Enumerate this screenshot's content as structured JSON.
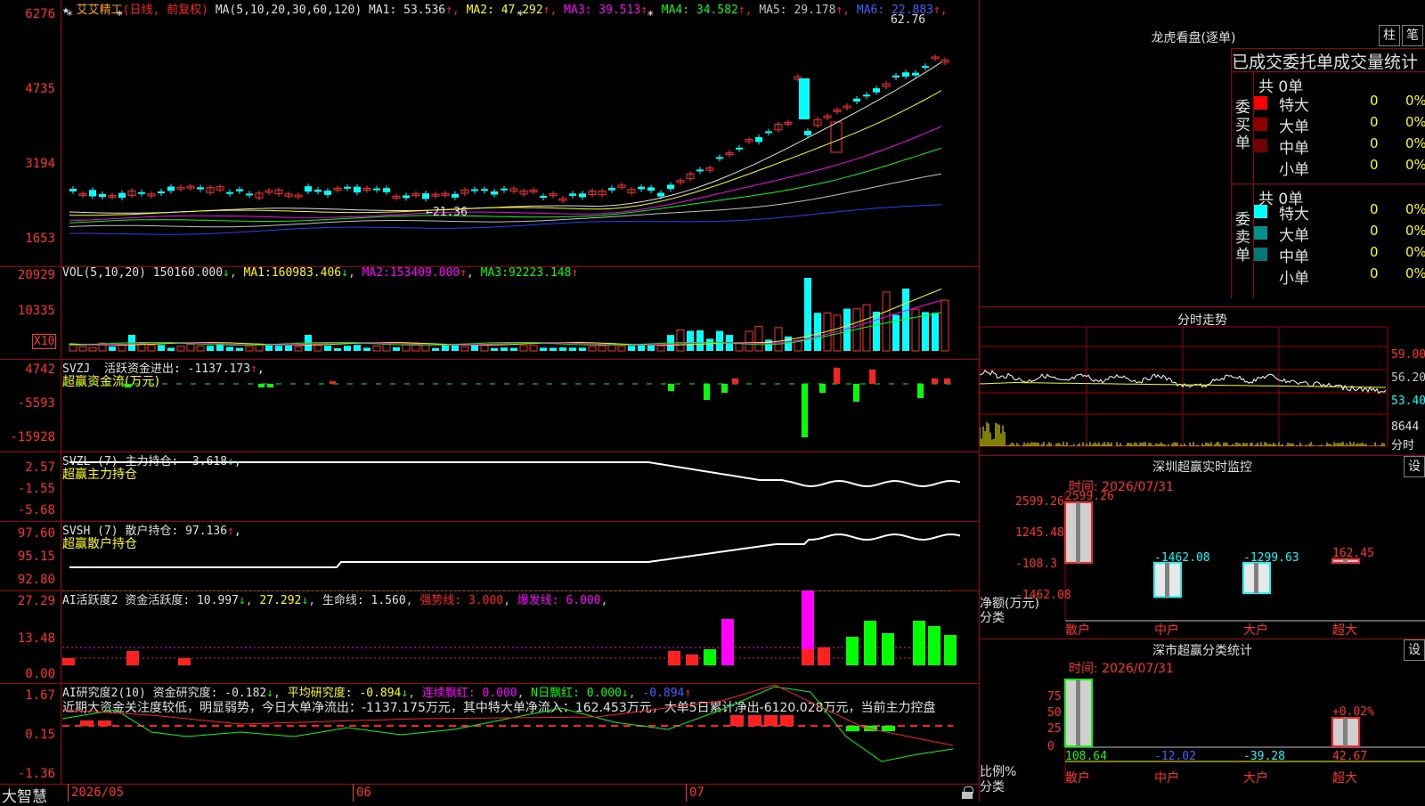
{
  "stock": {
    "name": "艾艾精工",
    "mode": "(日线, 前复权)",
    "ma_label": "MA(5,10,20,30,60,120)",
    "ma": [
      {
        "label": "MA1:",
        "value": "53.536",
        "arrow": "↑",
        "color": "#e0e0e0"
      },
      {
        "label": "MA2:",
        "value": "47.292",
        "arrow": "↑",
        "color": "#ffff00"
      },
      {
        "label": "MA3:",
        "value": "39.513",
        "arrow": "↑",
        "color": "#ff00ff"
      },
      {
        "label": "MA4:",
        "value": "34.582",
        "arrow": "↑",
        "color": "#00ff00"
      },
      {
        "label": "MA5:",
        "value": "29.178",
        "arrow": "↑",
        "color": "#c0c0c0"
      },
      {
        "label": "MA6:",
        "value": "22.883",
        "arrow": "↑",
        "color": "#4060ff"
      }
    ],
    "high_label": "62.76",
    "low_label": "←21.36"
  },
  "price_axis": [
    "6276",
    "4735",
    "3194",
    "1653"
  ],
  "vol": {
    "title": "VOL(5,10,20)",
    "value": "150160.000",
    "v_arrow": "↓",
    "ma1_label": "MA1:",
    "ma1": "160983.406",
    "ma1_arrow": "↓",
    "ma2_label": "MA2:",
    "ma2": "153409.000",
    "ma2_arrow": "↑",
    "ma3_label": "MA3:",
    "ma3": "92223.148",
    "ma3_arrow": "↑",
    "axis": [
      "20929",
      "10335"
    ],
    "unit": "X10"
  },
  "svzj": {
    "title": "SVZJ",
    "line_label": "活跃资金进出:",
    "line_value": "-1137.173",
    "arrow": "↑",
    "comma": ",",
    "sub": "超赢资金流(万元)",
    "axis": [
      "4742",
      "-5593",
      "-15928"
    ]
  },
  "svzl": {
    "title": "SVZL (7)",
    "line_label": "主力持仓:",
    "line_value": "-3.618",
    "arrow": "↓",
    "comma": ",",
    "sub": "超赢主力持仓",
    "axis": [
      "2.57",
      "-1.55",
      "-5.68"
    ]
  },
  "svsh": {
    "title": "SVSH (7)",
    "line_label": "散户持仓:",
    "line_value": "97.136",
    "arrow": "↑",
    "comma": ",",
    "sub": "超赢散户持仓",
    "axis": [
      "97.60",
      "95.15",
      "92.80"
    ]
  },
  "ai_act": {
    "title": "AI活跃度2",
    "l1": "资金活跃度:",
    "v1": "10.997",
    "a1": "↓",
    "v2": "27.292",
    "a2": "↓",
    "l3": "生命线:",
    "v3": "1.560",
    "l4": "强势线:",
    "v4": "3.000",
    "l5": "爆发线:",
    "v5": "6.000",
    "axis": [
      "27.29",
      "13.48",
      "0.00"
    ]
  },
  "ai_res": {
    "title": "AI研究度2(10)",
    "l1": "资金研究度:",
    "v1": "-0.182",
    "a1": "↓",
    "l2": "平均研究度:",
    "v2": "-0.894",
    "a2": "↓",
    "l3": "连续飘红:",
    "v3": "0.000",
    "l4": "N日飘红:",
    "v4": "0.000",
    "a4": "↓",
    "v5": "-0.894",
    "a5": "↑",
    "note": "近期大资金关注度较低，明显弱势，今日大单净流出：-1137.175万元，其中特大单净流入：162.453万元，大单5日累计净出-6120.028万元，当前主力控盘",
    "axis": [
      "1.67",
      "0.15",
      "-1.36"
    ]
  },
  "time_axis": {
    "brand": "大智慧",
    "labels": [
      "2026/05",
      "06",
      "07"
    ]
  },
  "right": {
    "dragon_title": "龙虎看盘(逐单)",
    "btn_zhu": "柱",
    "btn_bi": "笔",
    "stats_header": "已成交委托单成交量统计",
    "buy": {
      "side_label": "委买单",
      "total": "共 0单",
      "rows": [
        {
          "name": "特大",
          "n": "0",
          "p": "0%",
          "color": "#ff0000"
        },
        {
          "name": "大单",
          "n": "0",
          "p": "0%",
          "color": "#900000"
        },
        {
          "name": "中单",
          "n": "0",
          "p": "0%",
          "color": "#700000"
        },
        {
          "name": "小单",
          "n": "0",
          "p": "0%",
          "color": "#000000"
        }
      ]
    },
    "sell": {
      "side_label": "委卖单",
      "total": "共 0单",
      "rows": [
        {
          "name": "特大",
          "n": "0",
          "p": "0%",
          "color": "#00ffff"
        },
        {
          "name": "大单",
          "n": "0",
          "p": "0%",
          "color": "#009090"
        },
        {
          "name": "中单",
          "n": "0",
          "p": "0%",
          "color": "#007878"
        },
        {
          "name": "小单",
          "n": "0",
          "p": "0%",
          "color": "#000000"
        }
      ]
    },
    "intraday": {
      "title": "分时走势",
      "axis": [
        "59.00",
        "56.20",
        "53.40"
      ],
      "vol_label": "8644",
      "unit_label": "分时"
    },
    "monitor": {
      "title": "深圳超赢实时监控",
      "btn": "设",
      "time_label": "时间:",
      "time": "2026/07/31",
      "axis": [
        "2599.26",
        "1245.48",
        "-108.3",
        "-1462.08"
      ],
      "ylabel1": "净额(万元)",
      "ylabel2": "分类",
      "categories": [
        "散户",
        "中户",
        "大户",
        "超大"
      ],
      "values": [
        2599.26,
        -1462.08,
        -1299.63,
        162.45
      ],
      "value_labels": [
        "2599.26",
        "-1462.08",
        "-1299.63",
        "162.45"
      ]
    },
    "classify": {
      "title": "深市超赢分类统计",
      "btn": "设",
      "time_label": "时间:",
      "time": "2026/07/31",
      "axis": [
        "75",
        "50",
        "25",
        "0"
      ],
      "ylabel1": "比例%",
      "ylabel2": "分类",
      "categories": [
        "散户",
        "中户",
        "大户",
        "超大"
      ],
      "values": [
        108.64,
        -12.02,
        -39.28,
        42.67
      ],
      "value_labels": [
        "108.64",
        "-12.02",
        "-39.28",
        "42.67"
      ],
      "pct_label": "+0.02%"
    }
  }
}
